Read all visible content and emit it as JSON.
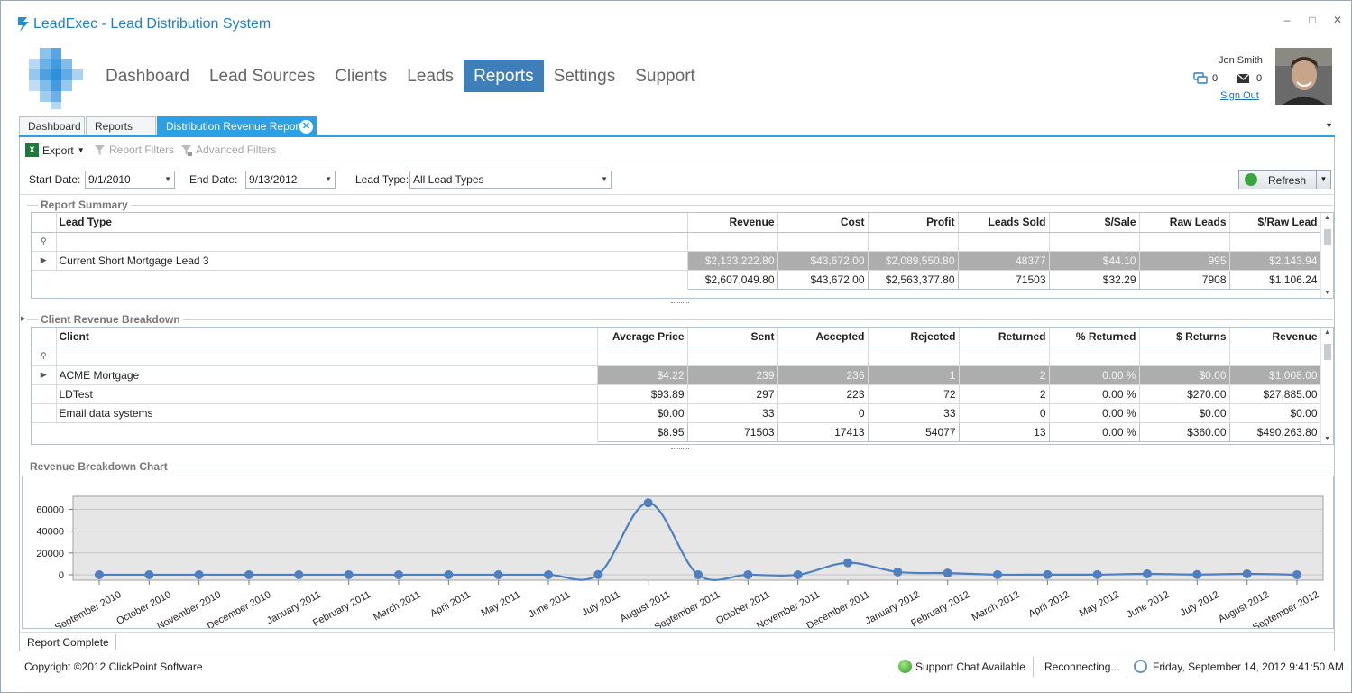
{
  "window": {
    "title": "LeadExec - Lead Distribution System",
    "minimize": "–",
    "maximize": "□",
    "close": "✕"
  },
  "nav": [
    "Dashboard",
    "Lead Sources",
    "Clients",
    "Leads",
    "Reports",
    "Settings",
    "Support"
  ],
  "nav_active": "Reports",
  "user": {
    "name": "Jon Smith",
    "chat_count": "0",
    "mail_count": "0",
    "sign_out": "Sign Out"
  },
  "tabs": [
    {
      "label": "Dashboard"
    },
    {
      "label": "Reports"
    },
    {
      "label": "Distribution Revenue Report",
      "active": true
    }
  ],
  "toolbar": {
    "export": "Export",
    "report_filters": "Report Filters",
    "advanced_filters": "Advanced Filters"
  },
  "filters": {
    "start_label": "Start Date:",
    "start_value": "9/1/2010",
    "end_label": "End Date:",
    "end_value": "9/13/2012",
    "type_label": "Lead Type:",
    "type_value": "All Lead Types",
    "refresh": "Refresh"
  },
  "summary": {
    "title": "Report Summary",
    "columns": [
      "Lead Type",
      "Revenue",
      "Cost",
      "Profit",
      "Leads Sold",
      "$/Sale",
      "Raw Leads",
      "$/Raw Lead"
    ],
    "rows": [
      [
        "Current Short Mortgage Lead 3",
        "$2,133,222.80",
        "$43,672.00",
        "$2,089,550.80",
        "48377",
        "$44.10",
        "995",
        "$2,143.94"
      ]
    ],
    "totals": [
      "$2,607,049.80",
      "$43,672.00",
      "$2,563,377.80",
      "71503",
      "$32.29",
      "7908",
      "$1,106.24"
    ]
  },
  "clients": {
    "title": "Client Revenue Breakdown",
    "columns": [
      "Client",
      "Average Price",
      "Sent",
      "Accepted",
      "Rejected",
      "Returned",
      "% Returned",
      "$ Returns",
      "Revenue"
    ],
    "rows": [
      [
        "ACME Mortgage",
        "$4.22",
        "239",
        "236",
        "1",
        "2",
        "0.00 %",
        "$0.00",
        "$1,008.00"
      ],
      [
        "LDTest",
        "$93.89",
        "297",
        "223",
        "72",
        "2",
        "0.00 %",
        "$270.00",
        "$27,885.00"
      ],
      [
        "Email data systems",
        "$0.00",
        "33",
        "0",
        "33",
        "0",
        "0.00 %",
        "$0.00",
        "$0.00"
      ]
    ],
    "totals": [
      "$8.95",
      "71503",
      "17413",
      "54077",
      "13",
      "0.00 %",
      "$360.00",
      "$490,263.80"
    ]
  },
  "chart_title": "Revenue Breakdown Chart",
  "chart_data": {
    "type": "line",
    "x": [
      "September 2010",
      "October 2010",
      "November 2010",
      "December 2010",
      "January 2011",
      "February 2011",
      "March 2011",
      "April 2011",
      "May 2011",
      "June 2011",
      "July 2011",
      "August 2011",
      "September 2011",
      "October 2011",
      "November 2011",
      "December 2011",
      "January 2012",
      "February 2012",
      "March 2012",
      "April 2012",
      "May 2012",
      "June 2012",
      "July 2012",
      "August 2012",
      "September 2012"
    ],
    "series": [
      {
        "values": [
          0,
          0,
          0,
          0,
          0,
          0,
          0,
          0,
          0,
          0,
          200,
          66000,
          0,
          0,
          0,
          11000,
          2500,
          1500,
          100,
          100,
          100,
          800,
          200,
          800,
          0
        ]
      }
    ],
    "yticks": [
      0,
      20000,
      40000,
      60000
    ],
    "ylim": [
      -5000,
      72000
    ],
    "grid": true,
    "colors": {
      "line": "#4f7fbf",
      "plot_bg": "#e6e6e6"
    }
  },
  "status": {
    "text": "Report Complete"
  },
  "footer": {
    "copyright": "Copyright ©2012 ClickPoint Software",
    "support_chat": "Support Chat Available",
    "reconnecting": "Reconnecting...",
    "datetime": "Friday, September 14, 2012 9:41:50 AM"
  }
}
